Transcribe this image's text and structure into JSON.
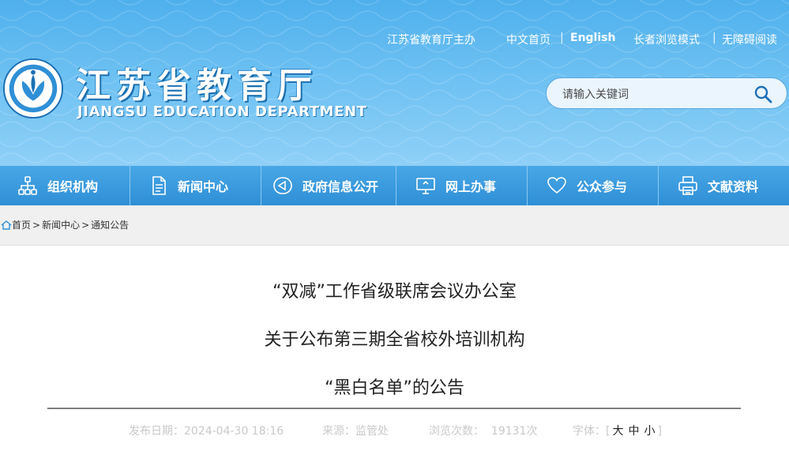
{
  "header": {
    "host": "江苏省教育厅主办",
    "home_cn": "中文首页",
    "separator": "|",
    "english": "English",
    "elder_mode": "长者浏览模式",
    "accessible": "无障碍阅读",
    "title_cn": "江苏省教育厅",
    "title_en": "JIANGSU EDUCATION DEPARTMENT",
    "logo_icon": "provincial-education-seal-icon",
    "search": {
      "placeholder": "请输入关键词",
      "icon": "search-icon"
    }
  },
  "nav": {
    "items": [
      {
        "label": "组织机构",
        "icon": "org-chart-icon"
      },
      {
        "label": "新闻中心",
        "icon": "document-icon"
      },
      {
        "label": "政府信息公开",
        "icon": "megaphone-icon"
      },
      {
        "label": "网上办事",
        "icon": "monitor-icon"
      },
      {
        "label": "公众参与",
        "icon": "heart-icon"
      },
      {
        "label": "文献资料",
        "icon": "printer-icon"
      }
    ]
  },
  "breadcrumb": {
    "icon": "home-icon",
    "items": [
      "首页",
      "新闻中心",
      "通知公告"
    ],
    "separator": ">"
  },
  "article": {
    "title_lines": [
      "“双减”工作省级联席会议办公室",
      "关于公布第三期全省校外培训机构",
      "“黑白名单”的公告"
    ],
    "meta": {
      "date_label": "发布日期：",
      "date": "2024-04-30 18:16",
      "source_label": "来源：",
      "source": "监管处",
      "views_label": "浏览次数：",
      "views": "19131次",
      "font_label": "字体：",
      "font_open": "[",
      "font_sizes": [
        "大",
        "中",
        "小"
      ],
      "font_close": "]"
    }
  },
  "colors": {
    "banner_top": "#4fb0ec",
    "nav_blue": "#2f8fd6",
    "breadcrumb_bg": "#f0f0f0",
    "meta_gray": "#c9c9c9"
  }
}
